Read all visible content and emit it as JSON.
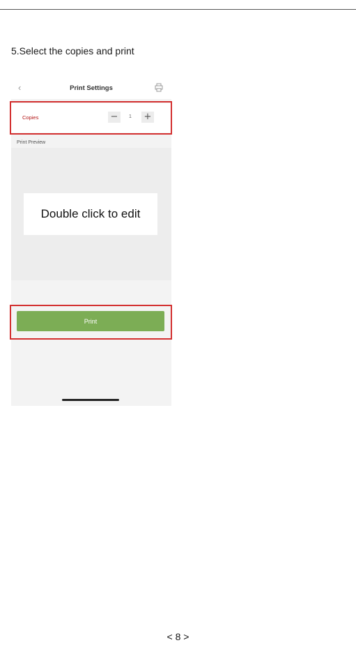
{
  "instruction": {
    "title": "5.Select the copies and print"
  },
  "app": {
    "header": {
      "back_icon": "chevron-left-icon",
      "title": "Print Settings",
      "action_icon": "printer-icon"
    },
    "copies": {
      "label": "Copies",
      "decrement": "−",
      "value": "1",
      "increment": "+"
    },
    "preview": {
      "label": "Print Preview",
      "placeholder": "Double click to edit"
    },
    "print_button": "Print",
    "highlight_color": "#d32f2f",
    "accent_color": "#7cad55"
  },
  "page": {
    "number": "< 8 >"
  }
}
